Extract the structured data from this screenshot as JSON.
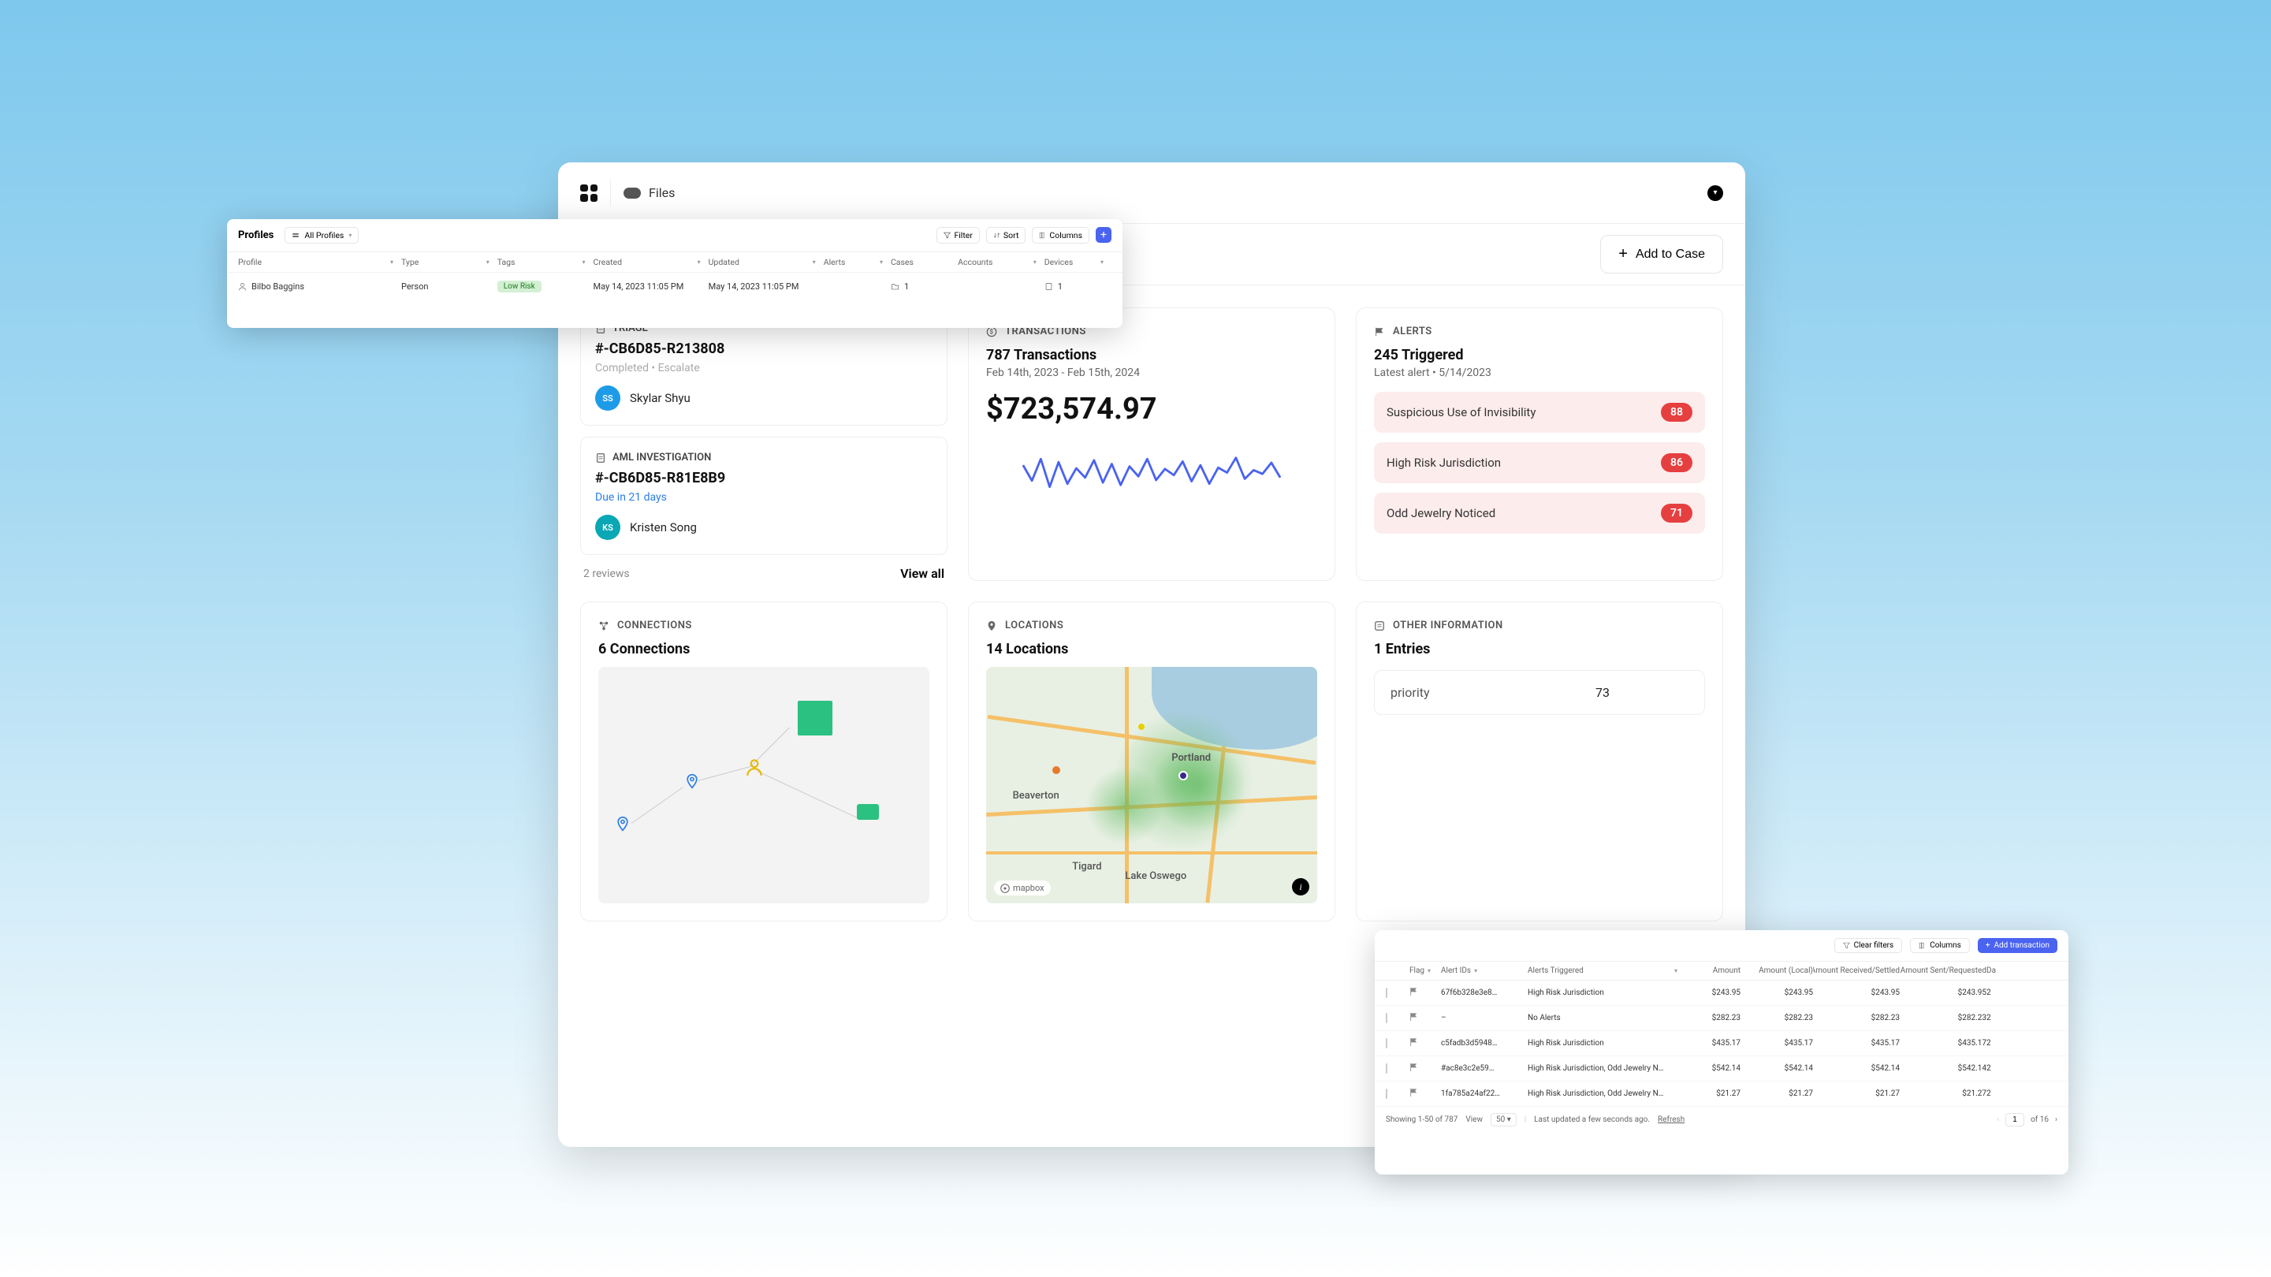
{
  "topbar": {
    "files_label": "Files"
  },
  "subbar": {
    "add_to_case": "Add to Case"
  },
  "triage": {
    "header": "TRIAGE",
    "id": "#-CB6D85-R213808",
    "status": "Completed  •  Escalate",
    "assignee": "Skylar Shyu",
    "initials": "SS"
  },
  "aml": {
    "header": "AML INVESTIGATION",
    "id": "#-CB6D85-R81E8B9",
    "due": "Due in 21 days",
    "assignee": "Kristen Song",
    "initials": "KS"
  },
  "reviews": {
    "count": "2 reviews",
    "view_all": "View all"
  },
  "transactions": {
    "header": "TRANSACTIONS",
    "title": "787 Transactions",
    "range": "Feb 14th, 2023 - Feb 15th, 2024",
    "amount": "$723,574.97"
  },
  "alerts": {
    "header": "ALERTS",
    "title": "245 Triggered",
    "latest": "Latest alert   •   5/14/2023",
    "items": [
      {
        "label": "Suspicious Use of Invisibility",
        "count": "88"
      },
      {
        "label": "High Risk Jurisdiction",
        "count": "86"
      },
      {
        "label": "Odd Jewelry Noticed",
        "count": "71"
      }
    ]
  },
  "connections": {
    "header": "CONNECTIONS",
    "title": "6 Connections"
  },
  "locations": {
    "header": "LOCATIONS",
    "title": "14 Locations",
    "badge": "mapbox",
    "labels": {
      "portland": "Portland",
      "beaverton": "Beaverton",
      "tigard": "Tigard",
      "lake_oswego": "Lake Oswego"
    }
  },
  "other": {
    "header": "OTHER INFORMATION",
    "title": "1 Entries",
    "key": "priority",
    "value": "73"
  },
  "profiles_panel": {
    "title": "Profiles",
    "dd": "All Profiles",
    "tools": {
      "filter": "Filter",
      "sort": "Sort",
      "columns": "Columns"
    },
    "cols": [
      "Profile",
      "Type",
      "Tags",
      "Created",
      "Updated",
      "Alerts",
      "Cases",
      "Accounts",
      "Devices"
    ],
    "row": {
      "profile": "Bilbo Baggins",
      "type": "Person",
      "tag": "Low Risk",
      "created": "May 14, 2023 11:05 PM",
      "updated": "May 14, 2023 11:05 PM",
      "cases": "1",
      "devices": "1"
    }
  },
  "tx_panel": {
    "tools": {
      "clear": "Clear filters",
      "columns": "Columns",
      "add": "Add transaction"
    },
    "cols": [
      "Flag",
      "Alert IDs",
      "Alerts Triggered",
      "Amount",
      "Amount (Local)",
      "Amount Received/Settled",
      "Amount Sent/Requested",
      "Da"
    ],
    "rows": [
      {
        "id": "67f6b328e3e8…",
        "alerts": "High Risk Jurisdiction",
        "a": "$243.95",
        "b": "$243.95",
        "c": "$243.95",
        "d": "$243.95",
        "date": "2"
      },
      {
        "id": "–",
        "alerts": "No Alerts",
        "a": "$282.23",
        "b": "$282.23",
        "c": "$282.23",
        "d": "$282.23",
        "date": "2"
      },
      {
        "id": "c5fadb3d5948…",
        "alerts": "High Risk Jurisdiction",
        "a": "$435.17",
        "b": "$435.17",
        "c": "$435.17",
        "d": "$435.17",
        "date": "2"
      },
      {
        "id": "#ac8e3c2e59…",
        "alerts": "High Risk Jurisdiction, Odd Jewelry N…",
        "a": "$542.14",
        "b": "$542.14",
        "c": "$542.14",
        "d": "$542.14",
        "date": "2"
      },
      {
        "id": "1fa785a24af22…",
        "alerts": "High Risk Jurisdiction, Odd Jewelry N…",
        "a": "$21.27",
        "b": "$21.27",
        "c": "$21.27",
        "d": "$21.27",
        "date": "2"
      }
    ],
    "footer": {
      "showing": "Showing 1-50 of 787",
      "view_label": "View",
      "view_value": "50",
      "updated": "Last updated a few seconds ago.",
      "refresh": "Refresh",
      "page": "1",
      "pages": "of 16"
    }
  },
  "chart_data": {
    "type": "line",
    "title": "Transactions sparkline",
    "x": [
      0,
      1,
      2,
      3,
      4,
      5,
      6,
      7,
      8,
      9,
      10,
      11,
      12,
      13,
      14,
      15,
      16,
      17,
      18,
      19,
      20,
      21,
      22,
      23,
      24,
      25,
      26,
      27,
      28,
      29
    ],
    "values": [
      60,
      35,
      70,
      25,
      65,
      30,
      55,
      40,
      68,
      32,
      62,
      28,
      58,
      42,
      70,
      36,
      54,
      44,
      66,
      34,
      60,
      30,
      56,
      48,
      72,
      38,
      52,
      46,
      64,
      40
    ],
    "ylim": [
      0,
      100
    ]
  }
}
